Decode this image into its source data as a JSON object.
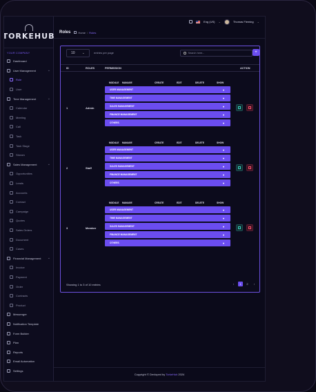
{
  "app": {
    "logo": "TORKEHUB"
  },
  "sidebar": {
    "section": "YOUR COMPANY",
    "items": [
      {
        "label": "Dashboard"
      },
      {
        "label": "User Management",
        "chevron": "⌄"
      },
      {
        "label": "Role",
        "active": true,
        "sub": true
      },
      {
        "label": "User",
        "sub": true
      },
      {
        "label": "Time Management",
        "chevron": "⌄"
      },
      {
        "label": "Calendar",
        "sub": true
      },
      {
        "label": "Meeting",
        "sub": true
      },
      {
        "label": "Call",
        "sub": true
      },
      {
        "label": "Task",
        "sub": true
      },
      {
        "label": "Task Stage",
        "sub": true
      },
      {
        "label": "Stream",
        "sub": true
      },
      {
        "label": "Sales Management",
        "chevron": "⌄"
      },
      {
        "label": "Opportunities",
        "sub": true
      },
      {
        "label": "Leads",
        "sub": true
      },
      {
        "label": "Accounts",
        "sub": true
      },
      {
        "label": "Contact",
        "sub": true
      },
      {
        "label": "Campaign",
        "sub": true
      },
      {
        "label": "Quotes",
        "sub": true
      },
      {
        "label": "Sales Orders",
        "sub": true
      },
      {
        "label": "Document",
        "sub": true
      },
      {
        "label": "Cases",
        "sub": true
      },
      {
        "label": "Financial Management",
        "chevron": "⌄"
      },
      {
        "label": "Invoice",
        "sub": true
      },
      {
        "label": "Payment",
        "sub": true
      },
      {
        "label": "Order",
        "sub": true
      },
      {
        "label": "Contracts",
        "sub": true
      },
      {
        "label": "Product",
        "sub": true
      },
      {
        "label": "Messenger"
      },
      {
        "label": "Notification Template"
      },
      {
        "label": "Form Builder"
      },
      {
        "label": "Plan"
      },
      {
        "label": "Reports"
      },
      {
        "label": "Email Automation"
      },
      {
        "label": "Settings"
      }
    ]
  },
  "topbar": {
    "language": "Eng (US)",
    "user": "Thomas Fleming"
  },
  "header": {
    "title": "Roles",
    "breadcrumb_home": "Home",
    "breadcrumb_current": "Roles"
  },
  "toolbar": {
    "per_page_value": "10",
    "per_page_label": "entries per page",
    "search_placeholder": "Search here..."
  },
  "table": {
    "headers": {
      "id": "ID",
      "roles": "ROLES",
      "permission": "PERMISSION",
      "action": "ACTION"
    },
    "perm_columns": [
      "MODULE",
      "MANAGE",
      "CREATE",
      "EDIT",
      "DELETE",
      "SHOW"
    ],
    "modules": [
      "USER MANAGEMENT",
      "TIME MANAGEMENT",
      "SALES MANAGEMENT",
      "FINANCE MANAGEMENT",
      "OTHERS"
    ],
    "rows": [
      {
        "id": "1",
        "role": "Admin"
      },
      {
        "id": "2",
        "role": "Staff"
      },
      {
        "id": "3",
        "role": "Member"
      }
    ]
  },
  "pagination": {
    "showing": "Showing 1 to 3 of 10 entries",
    "pages": [
      "1",
      "2"
    ],
    "current": "1"
  },
  "footer": {
    "prefix": "Copyright © Devloped by",
    "brand": "TorkeHub",
    "year": "2024"
  }
}
